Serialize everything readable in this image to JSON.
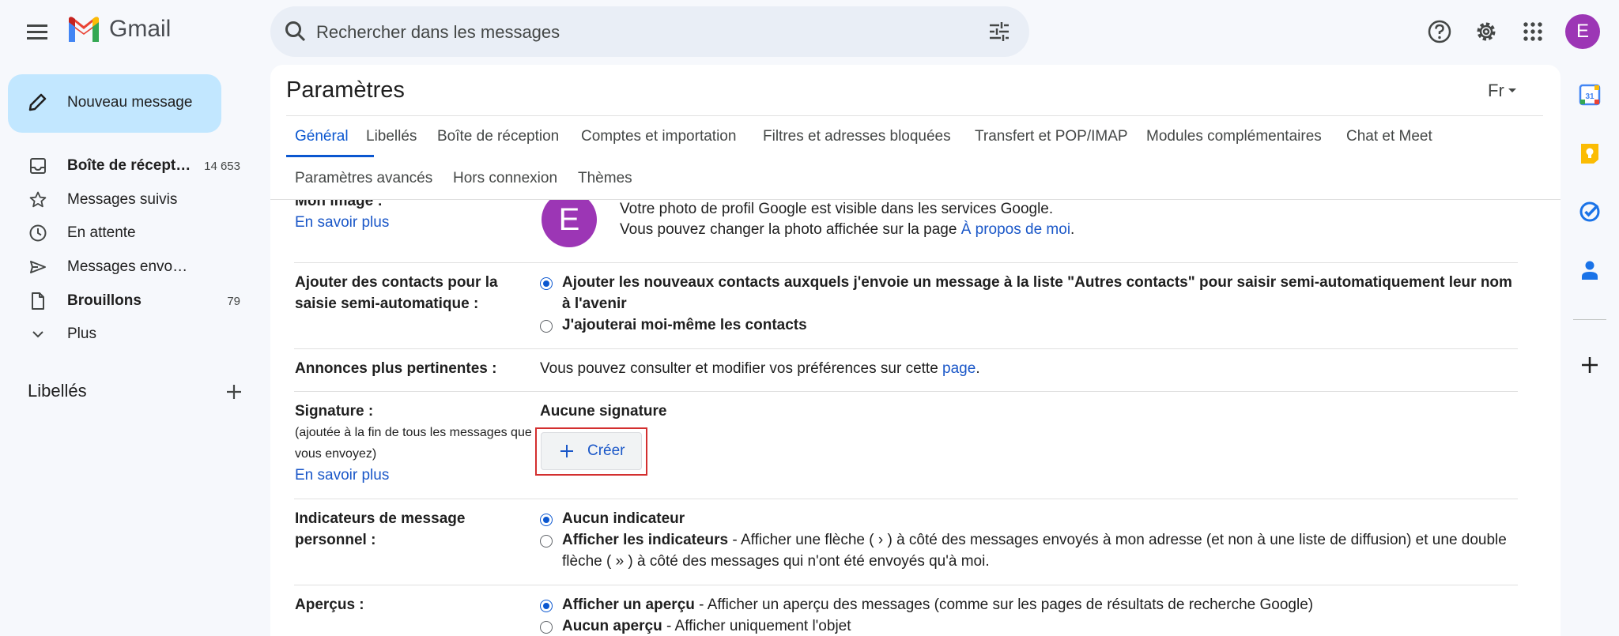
{
  "app": {
    "name": "Gmail"
  },
  "search": {
    "placeholder": "Rechercher dans les messages"
  },
  "account": {
    "initial": "E"
  },
  "compose": {
    "label": "Nouveau message"
  },
  "nav": [
    {
      "label": "Boîte de réception",
      "count": "14 653",
      "bold": true
    },
    {
      "label": "Messages suivis",
      "count": ""
    },
    {
      "label": "En attente",
      "count": ""
    },
    {
      "label": "Messages envoyés",
      "count": ""
    },
    {
      "label": "Brouillons",
      "count": "79",
      "bold": true
    },
    {
      "label": "Plus",
      "count": ""
    }
  ],
  "labels": {
    "title": "Libellés"
  },
  "settings": {
    "title": "Paramètres",
    "lang": "Fr",
    "tabs": [
      "Général",
      "Libellés",
      "Boîte de réception",
      "Comptes et importation",
      "Filtres et adresses bloquées",
      "Transfert et POP/IMAP",
      "Modules complémentaires",
      "Chat et Meet",
      "Paramètres avancés",
      "Hors connexion",
      "Thèmes"
    ],
    "image": {
      "label": "Mon image :",
      "learn_more": "En savoir plus",
      "initial": "E",
      "line1": "Votre photo de profil Google est visible dans les services Google.",
      "line2_prefix": "Vous pouvez changer la photo affichée sur la page ",
      "line2_link": "À propos de moi",
      "line2_suffix": "."
    },
    "contacts": {
      "label_line1": "Ajouter des contacts pour la",
      "label_line2": "saisie semi-automatique :",
      "option1_line1": "Ajouter les nouveaux contacts auxquels j'envoie un message à la liste \"Autres contacts\" pour saisir semi-automatiquement leur nom",
      "option1_line2": "à l'avenir",
      "option2": "J'ajouterai moi-même les contacts"
    },
    "ads": {
      "label": "Annonces plus pertinentes :",
      "text": "Vous pouvez consulter et modifier vos préférences sur cette ",
      "link": "page",
      "suffix": "."
    },
    "signature": {
      "label": "Signature :",
      "sub_line1": "(ajoutée à la fin de tous les messages que",
      "sub_line2": "vous envoyez)",
      "learn_more": "En savoir plus",
      "none": "Aucune signature",
      "create": "Créer"
    },
    "indicators": {
      "label_line1": "Indicateurs de message",
      "label_line2": "personnel :",
      "option1": "Aucun indicateur",
      "option2_bold": "Afficher les indicateurs",
      "option2_text_line1": " - Afficher une flèche ( › ) à côté des messages envoyés à mon adresse (et non à une liste de diffusion) et une double",
      "option2_text_line2": "flèche ( » ) à côté des messages qui n'ont été envoyés qu'à moi."
    },
    "previews": {
      "label": "Aperçus :",
      "option1_bold": "Afficher un aperçu",
      "option1_text": " - Afficher un aperçu des messages (comme sur les pages de résultats de recherche Google)",
      "option2_bold": "Aucun aperçu",
      "option2_text": " - Afficher uniquement l'objet"
    }
  },
  "colors": {
    "accent": "#0b57d0",
    "avatar": "#9c36b5",
    "compose_bg": "#c2e7ff",
    "highlight_border": "#d32f2f"
  }
}
